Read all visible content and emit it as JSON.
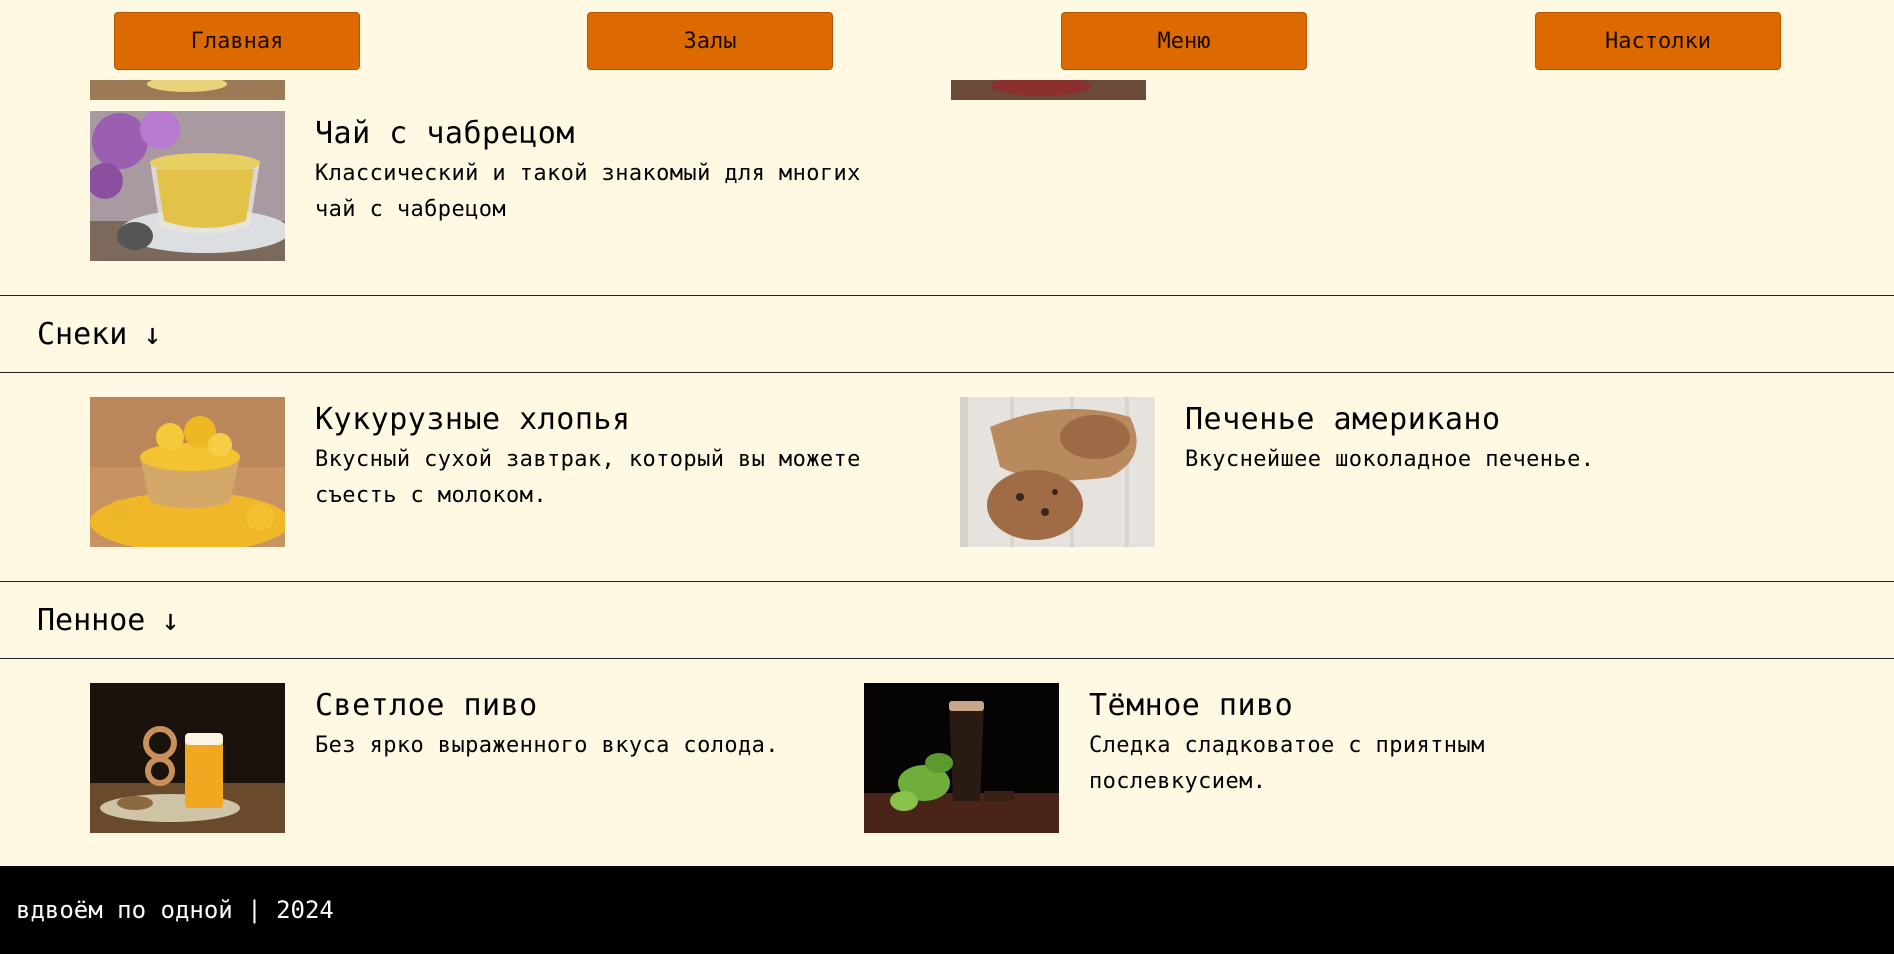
{
  "nav": {
    "home": "Главная",
    "halls": "Залы",
    "menu": "Меню",
    "games": "Настолки"
  },
  "items": {
    "thyme_tea": {
      "title": "Чай с чабрецом",
      "desc": "Классический и такой знакомый для многих чай с чабрецом"
    },
    "corn_flakes": {
      "title": "Кукурузные хлопья",
      "desc": "Вкусный сухой завтрак, который вы можете съесть с молоком."
    },
    "cookie": {
      "title": "Печенье американо",
      "desc": "Вкуснейшее шоколадное печенье."
    },
    "light_beer": {
      "title": "Светлое пиво",
      "desc": "Без ярко выраженного вкуса солода."
    },
    "dark_beer": {
      "title": "Тёмное пиво",
      "desc": "Следка сладковатое с приятным послевкусием."
    }
  },
  "sections": {
    "snacks": {
      "label": "Снеки",
      "arrow": "↓"
    },
    "beer": {
      "label": "Пенное",
      "arrow": "↓"
    }
  },
  "footer": {
    "text": "вдвоём по одной | 2024"
  },
  "colors": {
    "background": "#fff9e3",
    "nav_button": "#dc6a00",
    "footer": "#000000"
  }
}
